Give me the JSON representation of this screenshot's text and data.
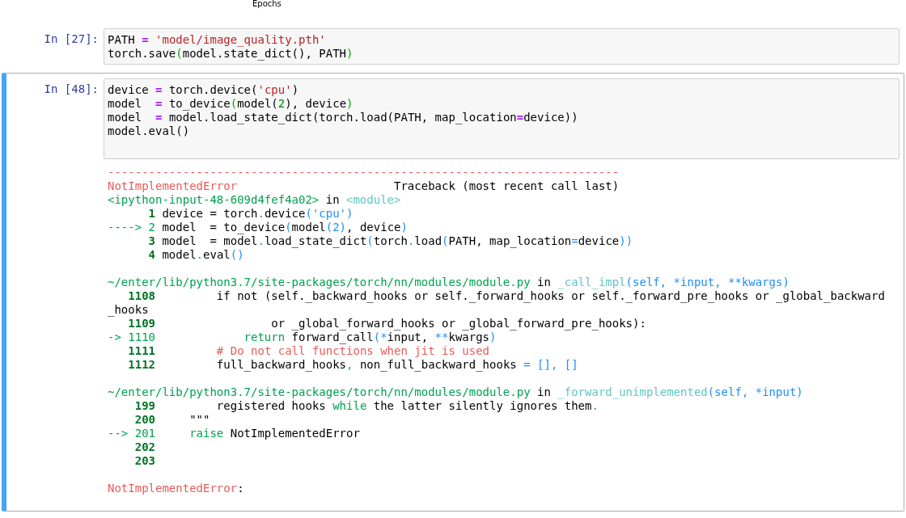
{
  "chart_caption": "Epochs",
  "cells": [
    {
      "prompt": "In [27]:",
      "selected": false,
      "source": [
        [
          {
            "t": "PATH ",
            "kind": "p"
          },
          {
            "t": "=",
            "kind": "op"
          },
          {
            "t": " 'model/image_quality.pth'",
            "kind": "str"
          }
        ],
        [
          {
            "t": "torch.save",
            "kind": "p"
          },
          {
            "t": "(",
            "kind": "br"
          },
          {
            "t": "model.state_dict(), PATH",
            "kind": "p"
          },
          {
            "t": ")",
            "kind": "br"
          }
        ]
      ]
    },
    {
      "prompt": "In [48]:",
      "selected": true,
      "source": [
        [
          {
            "t": "device ",
            "kind": "p"
          },
          {
            "t": "=",
            "kind": "op"
          },
          {
            "t": " torch.device(",
            "kind": "p"
          },
          {
            "t": "'cpu'",
            "kind": "str"
          },
          {
            "t": ")",
            "kind": "p"
          }
        ],
        [
          {
            "t": "model  ",
            "kind": "p"
          },
          {
            "t": "=",
            "kind": "op"
          },
          {
            "t": " to_device",
            "kind": "p"
          },
          {
            "t": "(",
            "kind": "br"
          },
          {
            "t": "model(",
            "kind": "p"
          },
          {
            "t": "2",
            "kind": "num"
          },
          {
            "t": "), device",
            "kind": "p"
          },
          {
            "t": ")",
            "kind": "br"
          }
        ],
        [
          {
            "t": "model  ",
            "kind": "p"
          },
          {
            "t": "=",
            "kind": "op"
          },
          {
            "t": " model.load_state_dict(torch.load(PATH, map_location",
            "kind": "p"
          },
          {
            "t": "=",
            "kind": "op"
          },
          {
            "t": "device))",
            "kind": "p"
          }
        ],
        [
          {
            "t": "model.eval()",
            "kind": "p"
          }
        ]
      ],
      "output": [
        [
          [
            {
              "t": "---------------------------------------------------------------------------",
              "kind": "red"
            }
          ],
          [
            {
              "t": "NotImplementedError",
              "kind": "red"
            },
            {
              "t": "                       Traceback (most recent call last)",
              "kind": "p"
            }
          ],
          [
            {
              "t": "<ipython-input-48-609d4fef4a02>",
              "kind": "grn"
            },
            {
              "t": " in ",
              "kind": "p"
            },
            {
              "t": "<module>",
              "kind": "cyan"
            }
          ],
          [
            {
              "t": "      1",
              "kind": "num"
            },
            {
              "t": " device = torch",
              "kind": "p"
            },
            {
              "t": ".",
              "kind": "blue"
            },
            {
              "t": "device",
              "kind": "p"
            },
            {
              "t": "('cpu')",
              "kind": "blue"
            }
          ],
          [
            {
              "t": "----> 2",
              "kind": "grn"
            },
            {
              "t": " model  = to_device",
              "kind": "p"
            },
            {
              "t": "(",
              "kind": "blue"
            },
            {
              "t": "model",
              "kind": "p"
            },
            {
              "t": "(2)",
              "kind": "blue"
            },
            {
              "t": ", device",
              "kind": "p"
            },
            {
              "t": ")",
              "kind": "blue"
            }
          ],
          [
            {
              "t": "      3",
              "kind": "num"
            },
            {
              "t": " model  = model",
              "kind": "p"
            },
            {
              "t": ".",
              "kind": "blue"
            },
            {
              "t": "load_state_dict",
              "kind": "p"
            },
            {
              "t": "(",
              "kind": "blue"
            },
            {
              "t": "torch",
              "kind": "p"
            },
            {
              "t": ".",
              "kind": "blue"
            },
            {
              "t": "load",
              "kind": "p"
            },
            {
              "t": "(",
              "kind": "blue"
            },
            {
              "t": "PATH, map_location",
              "kind": "p"
            },
            {
              "t": "=",
              "kind": "blue"
            },
            {
              "t": "device",
              "kind": "p"
            },
            {
              "t": "))",
              "kind": "blue"
            }
          ],
          [
            {
              "t": "      4",
              "kind": "num"
            },
            {
              "t": " model",
              "kind": "p"
            },
            {
              "t": ".",
              "kind": "blue"
            },
            {
              "t": "eval",
              "kind": "p"
            },
            {
              "t": "()",
              "kind": "blue"
            }
          ]
        ],
        [
          [
            {
              "t": "~/enter/lib/python3.7/site-packages/torch/nn/modules/module.py",
              "kind": "grn"
            },
            {
              "t": " in ",
              "kind": "p"
            },
            {
              "t": "_call_impl",
              "kind": "cyan"
            },
            {
              "t": "(self, *input, **kwargs)",
              "kind": "blue"
            }
          ],
          [
            {
              "t": "   1108",
              "kind": "num"
            },
            {
              "t": "         if not (self._backward_hooks or self._forward_hooks or self._forward_pre_hooks or _global_backward",
              "kind": "p"
            }
          ],
          [
            {
              "t": "_hooks",
              "kind": "p"
            }
          ],
          [
            {
              "t": "   1109",
              "kind": "num"
            },
            {
              "t": "                 or _global_forward_hooks or _global_forward_pre_hooks):",
              "kind": "p"
            }
          ],
          [
            {
              "t": "-> 1110             return",
              "kind": "grn"
            },
            {
              "t": " forward_call",
              "kind": "p"
            },
            {
              "t": "(*",
              "kind": "blue"
            },
            {
              "t": "input, ",
              "kind": "p"
            },
            {
              "t": "**",
              "kind": "blue"
            },
            {
              "t": "kwargs",
              "kind": "p"
            },
            {
              "t": ")",
              "kind": "blue"
            }
          ],
          [
            {
              "t": "   1111",
              "kind": "num"
            },
            {
              "t": "         # Do not call functions when jit is used",
              "kind": "red"
            }
          ],
          [
            {
              "t": "   1112",
              "kind": "num"
            },
            {
              "t": "         full_backward_hooks",
              "kind": "p"
            },
            {
              "t": ",",
              "kind": "blue"
            },
            {
              "t": " non_full_backward_hooks ",
              "kind": "p"
            },
            {
              "t": "= [], []",
              "kind": "blue"
            }
          ]
        ],
        [
          [
            {
              "t": "~/enter/lib/python3.7/site-packages/torch/nn/modules/module.py",
              "kind": "grn"
            },
            {
              "t": " in ",
              "kind": "p"
            },
            {
              "t": "_forward_unimplemented",
              "kind": "cyan"
            },
            {
              "t": "(self, *input)",
              "kind": "blue"
            }
          ],
          [
            {
              "t": "    199",
              "kind": "num"
            },
            {
              "t": "         registered hooks ",
              "kind": "p"
            },
            {
              "t": "while",
              "kind": "grn"
            },
            {
              "t": " the latter silently ignores them",
              "kind": "p"
            },
            {
              "t": ".",
              "kind": "blue"
            }
          ],
          [
            {
              "t": "    200",
              "kind": "num"
            },
            {
              "t": "     \"\"\"",
              "kind": "p"
            }
          ],
          [
            {
              "t": "--> 201     raise",
              "kind": "grn"
            },
            {
              "t": " NotImplementedError",
              "kind": "p"
            }
          ],
          [
            {
              "t": "    202",
              "kind": "num"
            }
          ],
          [
            {
              "t": "    203",
              "kind": "num"
            }
          ]
        ],
        [
          [
            {
              "t": "NotImplementedError",
              "kind": "red"
            },
            {
              "t": ":",
              "kind": "p"
            }
          ]
        ]
      ]
    }
  ]
}
